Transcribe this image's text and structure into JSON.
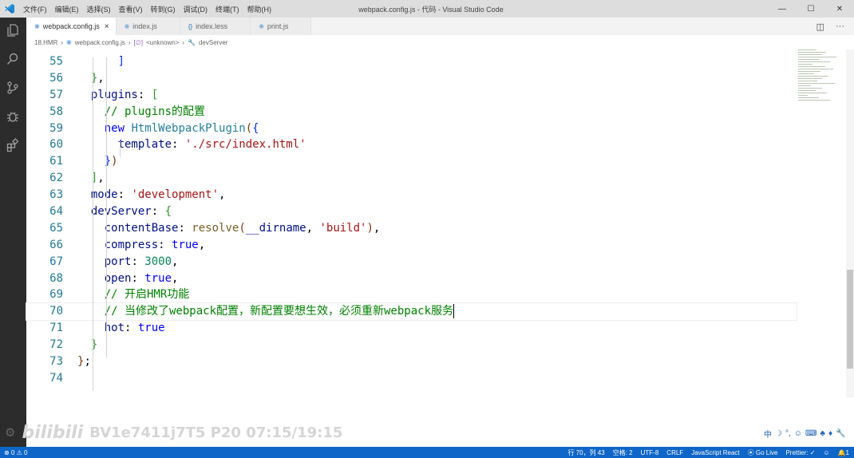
{
  "title_bar": {
    "menus": [
      "文件(F)",
      "编辑(E)",
      "选择(S)",
      "查看(V)",
      "转到(G)",
      "调试(D)",
      "终端(T)",
      "帮助(H)"
    ],
    "window_title": "webpack.config.js - 代码 - Visual Studio Code",
    "controls": [
      "—",
      "☐",
      "✕"
    ]
  },
  "tabs": [
    {
      "icon": "webpack-file-icon",
      "label": "webpack.config.js",
      "active": true
    },
    {
      "icon": "js-file-icon",
      "label": "index.js",
      "active": false
    },
    {
      "icon": "less-file-icon",
      "label": "index.less",
      "active": false
    },
    {
      "icon": "js-file-icon",
      "label": "print.js",
      "active": false
    }
  ],
  "breadcrumb": [
    "18.HMR",
    "webpack.config.js",
    "<unknown>",
    "devServer"
  ],
  "editor": {
    "line_numbers": [
      "55",
      "56",
      "57",
      "58",
      "59",
      "60",
      "61",
      "62",
      "63",
      "64",
      "65",
      "66",
      "67",
      "68",
      "69",
      "70",
      "71",
      "72",
      "73",
      "74"
    ],
    "current_line": "70",
    "lines": [
      {
        "tokens": [
          [
            "      ",
            ""
          ],
          [
            "]",
            "b1"
          ]
        ]
      },
      {
        "tokens": [
          [
            "  ",
            ""
          ],
          [
            "}",
            "b2"
          ],
          [
            ",",
            ""
          ]
        ]
      },
      {
        "tokens": [
          [
            "  ",
            ""
          ],
          [
            "plugins",
            "p"
          ],
          [
            ": ",
            ""
          ],
          [
            "[",
            "b2"
          ]
        ]
      },
      {
        "tokens": [
          [
            "    ",
            ""
          ],
          [
            "// plugins的配置",
            "c"
          ]
        ]
      },
      {
        "tokens": [
          [
            "    ",
            ""
          ],
          [
            "new ",
            "k"
          ],
          [
            "HtmlWebpackPlugin",
            "cls"
          ],
          [
            "(",
            "b3"
          ],
          [
            "{",
            "b1"
          ]
        ]
      },
      {
        "tokens": [
          [
            "      ",
            ""
          ],
          [
            "template",
            "p"
          ],
          [
            ": ",
            ""
          ],
          [
            "'./src/index.html'",
            "s"
          ]
        ]
      },
      {
        "tokens": [
          [
            "    ",
            ""
          ],
          [
            "}",
            "b1"
          ],
          [
            ")",
            "b3"
          ]
        ]
      },
      {
        "tokens": [
          [
            "  ",
            ""
          ],
          [
            "]",
            "b2"
          ],
          [
            ",",
            ""
          ]
        ]
      },
      {
        "tokens": [
          [
            "  ",
            ""
          ],
          [
            "mode",
            "p"
          ],
          [
            ": ",
            ""
          ],
          [
            "'development'",
            "s"
          ],
          [
            ",",
            ""
          ]
        ]
      },
      {
        "tokens": [
          [
            "  ",
            ""
          ],
          [
            "devServer",
            "p"
          ],
          [
            ": ",
            ""
          ],
          [
            "{",
            "b2"
          ]
        ]
      },
      {
        "tokens": [
          [
            "    ",
            ""
          ],
          [
            "contentBase",
            "p"
          ],
          [
            ": ",
            ""
          ],
          [
            "resolve",
            "f"
          ],
          [
            "(",
            "b3"
          ],
          [
            "__dirname",
            "p"
          ],
          [
            ", ",
            ""
          ],
          [
            "'build'",
            "s"
          ],
          [
            ")",
            "b3"
          ],
          [
            ",",
            ""
          ]
        ]
      },
      {
        "tokens": [
          [
            "    ",
            ""
          ],
          [
            "compress",
            "p"
          ],
          [
            ": ",
            ""
          ],
          [
            "true",
            "k"
          ],
          [
            ",",
            ""
          ]
        ]
      },
      {
        "tokens": [
          [
            "    ",
            ""
          ],
          [
            "port",
            "p"
          ],
          [
            ": ",
            ""
          ],
          [
            "3000",
            "n"
          ],
          [
            ",",
            ""
          ]
        ]
      },
      {
        "tokens": [
          [
            "    ",
            ""
          ],
          [
            "open",
            "p"
          ],
          [
            ": ",
            ""
          ],
          [
            "true",
            "k"
          ],
          [
            ",",
            ""
          ]
        ]
      },
      {
        "tokens": [
          [
            "    ",
            ""
          ],
          [
            "// 开启HMR功能",
            "c"
          ]
        ]
      },
      {
        "tokens": [
          [
            "    ",
            ""
          ],
          [
            "// 当修改了webpack配置，新配置要想生效，必须重新webpack服务",
            "c"
          ]
        ]
      },
      {
        "tokens": [
          [
            "    ",
            ""
          ],
          [
            "hot",
            "p"
          ],
          [
            ": ",
            ""
          ],
          [
            "true",
            "k"
          ]
        ]
      },
      {
        "tokens": [
          [
            "  ",
            ""
          ],
          [
            "}",
            "b2"
          ]
        ]
      },
      {
        "tokens": [
          [
            "}",
            "b3"
          ],
          [
            ";",
            ""
          ]
        ]
      },
      {
        "tokens": []
      }
    ]
  },
  "watermark": {
    "logo": "bilibili",
    "text": "BV1e7411j7T5 P20 07:15/19:15"
  },
  "ime": [
    "中",
    "☽",
    "°,",
    "☺",
    "⌨",
    "♣",
    "♦",
    "🔧"
  ],
  "status_bar": {
    "errors": "0",
    "warnings": "0",
    "position": "行 70，列 43",
    "indent": "空格: 2",
    "encoding": "UTF-8",
    "eol": "CRLF",
    "language": "JavaScript React",
    "live": "Go Live",
    "prettier": "Prettier: ✓",
    "notifications": "1"
  },
  "colors": {
    "status_bar": "#0e66c8",
    "activity_bar": "#2c2c2c",
    "comment": "#008000",
    "string": "#a31515",
    "keyword": "#0000ff"
  }
}
